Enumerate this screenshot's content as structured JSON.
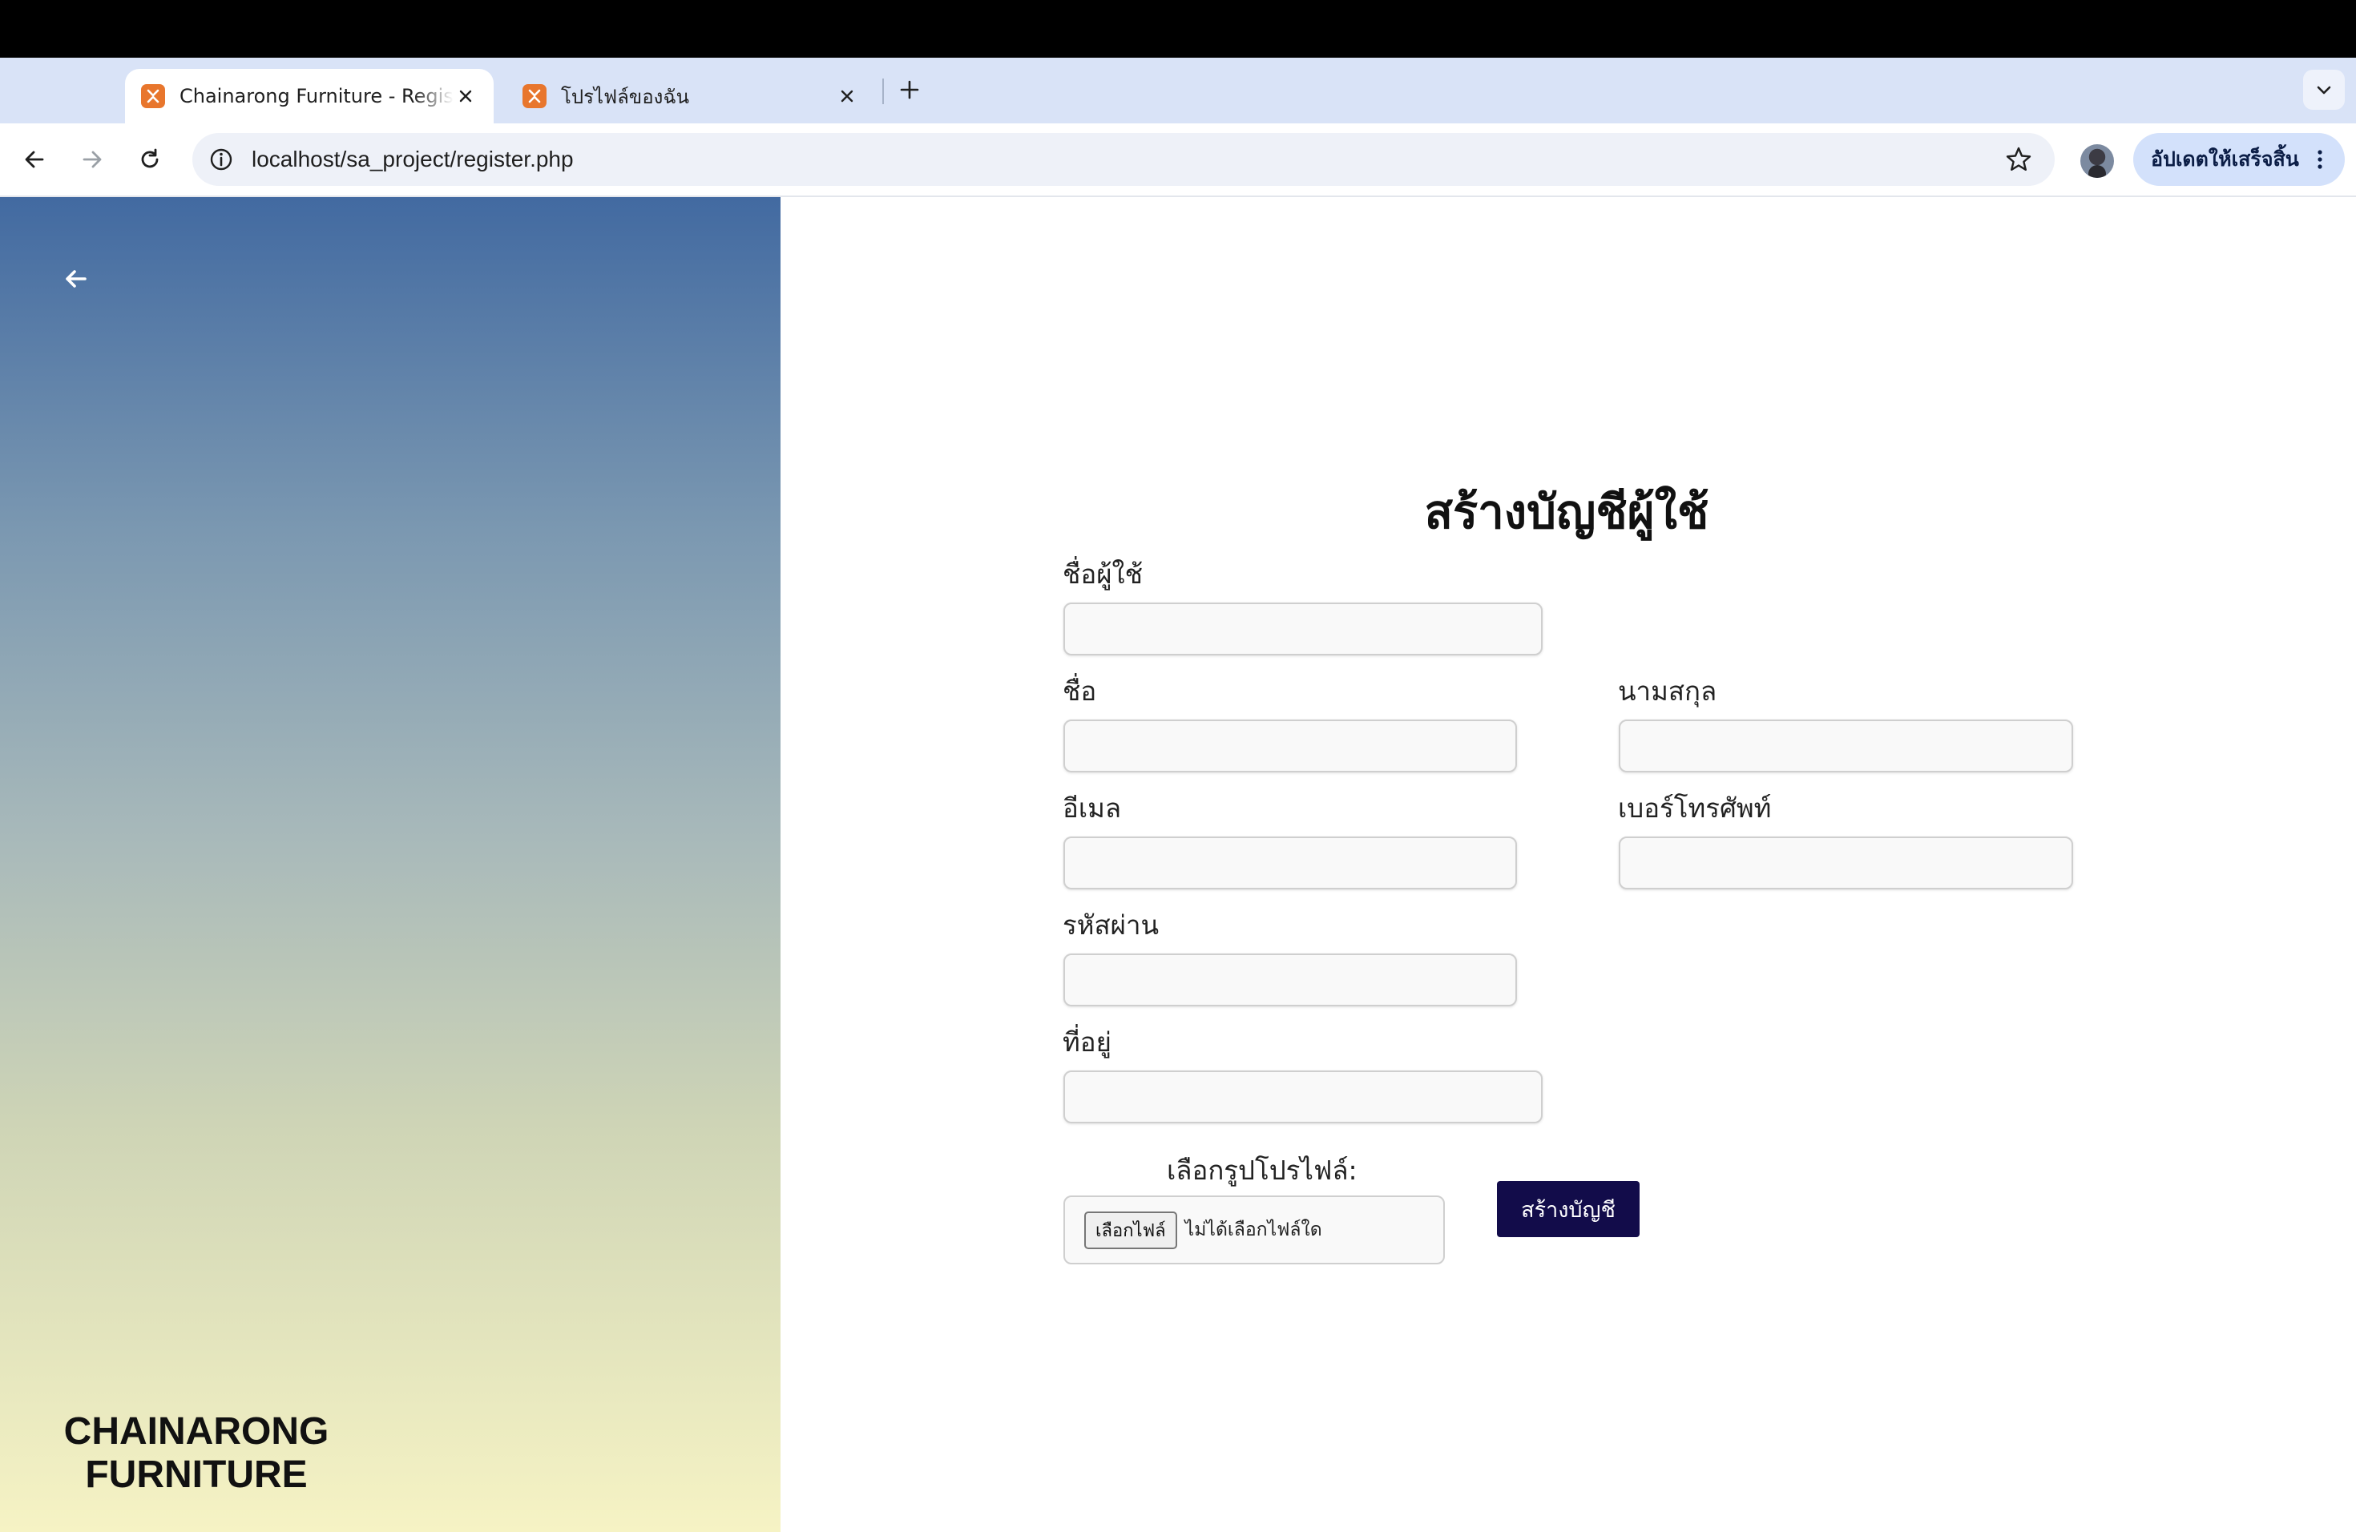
{
  "browser": {
    "tabs": [
      {
        "title": "Chainarong Furniture - Register",
        "active": true
      },
      {
        "title": "โปรไฟล์ของฉัน",
        "active": false
      }
    ],
    "url": "localhost/sa_project/register.php",
    "update_button_label": "อัปเดตให้เสร็จสิ้น"
  },
  "sidebar": {
    "brand_line1": "CHAINARONG",
    "brand_line2": "FURNITURE"
  },
  "form": {
    "title": "สร้างบัญชีผู้ใช้",
    "fields": {
      "username": {
        "label": "ชื่อผู้ใช้",
        "value": ""
      },
      "first_name": {
        "label": "ชื่อ",
        "value": ""
      },
      "last_name": {
        "label": "นามสกุล",
        "value": ""
      },
      "email": {
        "label": "อีเมล",
        "value": ""
      },
      "phone": {
        "label": "เบอร์โทรศัพท์",
        "value": ""
      },
      "password": {
        "label": "รหัสผ่าน",
        "value": ""
      },
      "address": {
        "label": "ที่อยู่",
        "value": ""
      }
    },
    "profile_picture": {
      "label": "เลือกรูปโปรไฟล์:",
      "button_label": "เลือกไฟล์",
      "status": "ไม่ได้เลือกไฟล์ใด"
    },
    "submit_label": "สร้างบัญชี"
  },
  "colors": {
    "favicon": "#e8762d",
    "submit_button": "#120c4a",
    "gradient_top": "#426aa1",
    "gradient_bottom": "#f6f3c4"
  }
}
